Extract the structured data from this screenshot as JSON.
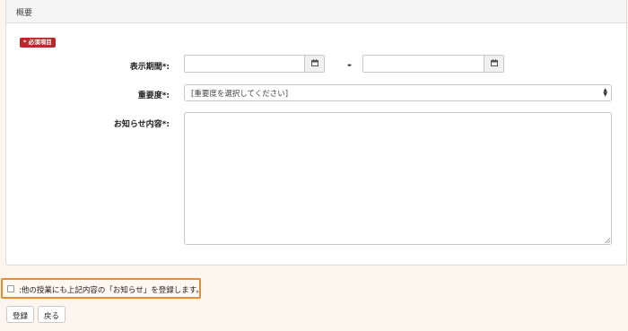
{
  "panel": {
    "heading": "概要",
    "required_badge": "* 必須項目"
  },
  "form": {
    "display_period_label": "表示期間*:",
    "date_start_value": "",
    "date_end_value": "",
    "date_separator": "-",
    "importance_label": "重要度*:",
    "importance_selected": "[重要度を選択してください]",
    "content_label": "お知らせ内容*:",
    "content_value": ""
  },
  "options": {
    "register_other_classes_label": ":他の授業にも上記内容の「お知らせ」を登録します。",
    "register_other_classes_checked": false
  },
  "actions": {
    "register_label": "登録",
    "back_label": "戻る"
  },
  "colors": {
    "required_badge_bg": "#b52a2a",
    "highlight_border": "#ec8a2f"
  }
}
